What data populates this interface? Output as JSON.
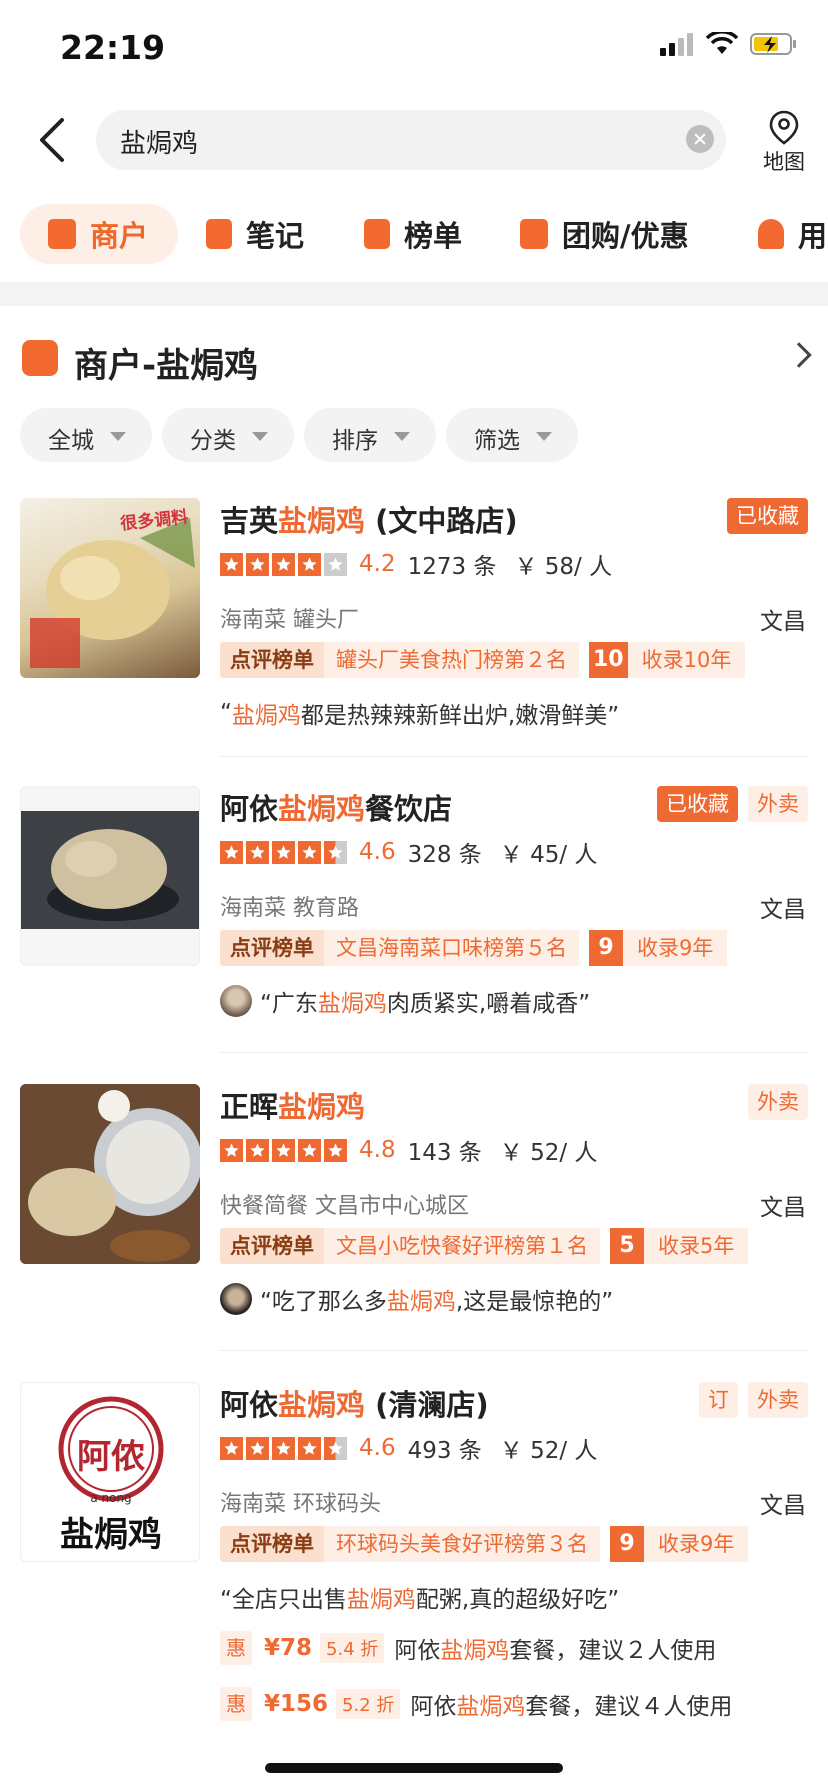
{
  "status": {
    "time": "22:19"
  },
  "search": {
    "query": "盐焗鸡",
    "map_label": "地图"
  },
  "tabs": [
    "商户",
    "笔记",
    "榜单",
    "团购/优惠",
    "用"
  ],
  "section": {
    "title": "商户-盐焗鸡"
  },
  "filters": [
    "全城",
    "分类",
    "排序",
    "筛选"
  ],
  "shops": [
    {
      "name_pre": "吉英",
      "name_hl": "盐焗鸡",
      "name_post": " (文中路店)",
      "badges": [
        "已收藏"
      ],
      "rating": 4.2,
      "score": "4.2",
      "reviews": "1273 条",
      "price": "￥ 58/ 人",
      "meta": "海南菜  罐头厂",
      "city": "文昌",
      "rank_label": "点评榜单",
      "rank_text": "罐头厂美食热门榜第２名",
      "years_num": "10",
      "years_text": "收录10年",
      "quote_open": "“",
      "quote_hl": "盐焗鸡",
      "quote_rest": "都是热辣辣新鲜出炉,嫩滑鲜美”",
      "thumb_text": "很多调料"
    },
    {
      "name_pre": "阿依",
      "name_hl": "盐焗鸡",
      "name_post": "餐饮店",
      "badges": [
        "已收藏",
        "外卖"
      ],
      "rating": 4.6,
      "score": "4.6",
      "reviews": "328 条",
      "price": "￥ 45/ 人",
      "meta": "海南菜  教育路",
      "city": "文昌",
      "rank_label": "点评榜单",
      "rank_text": "文昌海南菜口味榜第５名",
      "years_num": "9",
      "years_text": "收录9年",
      "quote_open": "“广东",
      "quote_hl": "盐焗鸡",
      "quote_rest": "肉质紧实,嚼着咸香”"
    },
    {
      "name_pre": "正晖",
      "name_hl": "盐焗鸡",
      "name_post": "",
      "badges": [
        "外卖"
      ],
      "rating": 4.8,
      "score": "4.8",
      "reviews": "143 条",
      "price": "￥ 52/ 人",
      "meta": "快餐简餐  文昌市中心城区",
      "city": "文昌",
      "rank_label": "点评榜单",
      "rank_text": "文昌小吃快餐好评榜第１名",
      "years_num": "5",
      "years_text": "收录5年",
      "quote_open": "“吃了那么多",
      "quote_hl": "盐焗鸡",
      "quote_rest": ",这是最惊艳的”"
    },
    {
      "name_pre": "阿依",
      "name_hl": "盐焗鸡",
      "name_post": " (清澜店)",
      "badges": [
        "订",
        "外卖"
      ],
      "rating": 4.6,
      "score": "4.6",
      "reviews": "493 条",
      "price": "￥ 52/ 人",
      "meta": "海南菜  环球码头",
      "city": "文昌",
      "rank_label": "点评榜单",
      "rank_text": "环球码头美食好评榜第３名",
      "years_num": "9",
      "years_text": "收录9年",
      "quote_open": "“全店只出售",
      "quote_hl": "盐焗鸡",
      "quote_rest": "配粥,真的超级好吃”",
      "logo_text": "阿侬",
      "logo_sub": "a nong",
      "logo_name": "盐焗鸡",
      "deals": [
        {
          "tag": "惠",
          "price": "¥78",
          "discount": "5.4 折",
          "pre": "阿依",
          "hl": "盐焗鸡",
          "post": "套餐，建议２人使用"
        },
        {
          "tag": "惠",
          "price": "¥156",
          "discount": "5.2 折",
          "pre": "阿依",
          "hl": "盐焗鸡",
          "post": "套餐，建议４人使用"
        }
      ]
    }
  ],
  "colors": {
    "accent": "#ef6a33",
    "accent_light": "#fdeee6"
  }
}
